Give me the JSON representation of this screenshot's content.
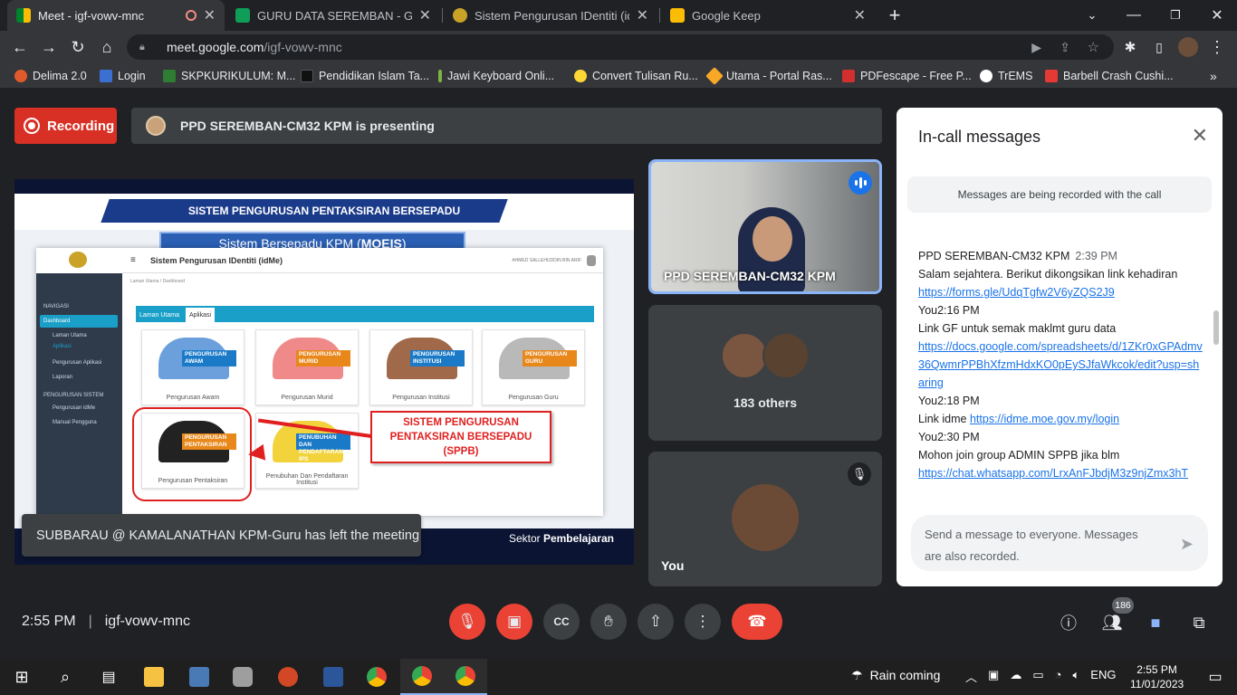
{
  "browser": {
    "tabs": [
      {
        "title": "Meet - igf-vowv-mnc",
        "active": true
      },
      {
        "title": "GURU DATA SEREMBAN - Google"
      },
      {
        "title": "Sistem Pengurusan IDentiti (idMe"
      },
      {
        "title": "Google Keep"
      }
    ],
    "url_domain": "meet.google.com",
    "url_path": "/igf-vowv-mnc",
    "bookmarks": [
      "Delima 2.0",
      "Login",
      "SKPKURIKULUM: M...",
      "Pendidikan Islam Ta...",
      "Jawi Keyboard Onli...",
      "Convert Tulisan Ru...",
      "Utama - Portal Ras...",
      "PDFescape - Free P...",
      "TrEMS",
      "Barbell Crash Cushi..."
    ]
  },
  "meet": {
    "recording_label": "Recording",
    "presenting_text": "PPD SEREMBAN-CM32 KPM is presenting",
    "slide": {
      "title": "SISTEM PENGURUSAN PENTAKSIRAN BERSEPADU",
      "subtitle_prefix": "Sistem Bersepadu KPM (",
      "subtitle_bold": "MOEIS",
      "subtitle_suffix": ")",
      "app_title": "Sistem Pengurusan IDentiti (idMe)",
      "app_user": "AHMED SALLEHUDDIN BIN ARIF",
      "breadcrumb": "Laman Utama  /  Dashboard",
      "sidebar": [
        "NAVIGASI",
        "Dashboard",
        "Laman Utama",
        "Aplikasi",
        "Pengurusan Aplikasi",
        "Laporan",
        "PENGURUSAN SISTEM",
        "Pengurusan idMe",
        "Manual Pengguna"
      ],
      "tabs": [
        "Laman Utama",
        "Aplikasi"
      ],
      "cards": [
        {
          "caption": "Pengurusan Awam",
          "l1": "PENGURUSAN",
          "l2": "AWAM"
        },
        {
          "caption": "Pengurusan Murid",
          "l1": "PENGURUSAN",
          "l2": "MURID"
        },
        {
          "caption": "Pengurusan Institusi",
          "l1": "PENGURUSAN",
          "l2": "INSTITUSI"
        },
        {
          "caption": "Pengurusan Guru",
          "l1": "PENGURUSAN",
          "l2": "GURU"
        },
        {
          "caption": "Pengurusan Pentaksiran",
          "l1": "PENGURUSAN",
          "l2": "PENTAKSIRAN"
        },
        {
          "caption": "Penubuhan Dan Pendaftaran Institusi",
          "l1": "PENUBUHAN DAN",
          "l2": "PENDAFTARAN IPS"
        }
      ],
      "card_subtext": "KEMENTERIAN PENDIDIKAN",
      "callout": "SISTEM PENGURUSAN PENTAKSIRAN BERSEPADU (SPPB)",
      "footer_prefix": "Sektor ",
      "footer_bold": "Pembelajaran"
    },
    "toast": "SUBBARAU @ KAMALANATHAN KPM-Guru has left the meeting",
    "tiles": {
      "presenter_name": "PPD SEREMBAN-CM32 KPM",
      "others_label": "183 others",
      "self_label": "You"
    },
    "meeting_time": "2:55 PM",
    "meeting_code": "igf-vowv-mnc",
    "participant_count": "186"
  },
  "chat": {
    "title": "In-call messages",
    "notice": "Messages are being recorded with the call",
    "sender": "PPD SEREMBAN-CM32 KPM",
    "sender_time": "2:39 PM",
    "messages": [
      {
        "text": "Salam sejahtera. Berikut dikongsikan link kehadiran"
      },
      {
        "link": "https://forms.gle/UdqTgfw2V6yZQS2J9"
      },
      {
        "text": "You2:16 PM"
      },
      {
        "text": "Link GF untuk semak maklmt guru data"
      },
      {
        "link": "https://docs.google.com/spreadsheets/d/1ZKr0xGPAdmv36QwmrPPBhXfzmHdxKO0pEySJfaWkcok/edit?usp=sharing"
      },
      {
        "text": "You2:18 PM"
      },
      {
        "text": "Link idme ",
        "link": "https://idme.moe.gov.my/login"
      },
      {
        "text": "You2:30 PM"
      },
      {
        "text": "Mohon join group ADMIN SPPB jika blm"
      },
      {
        "link": "https://chat.whatsapp.com/LrxAnFJbdjM3z9njZmx3hT"
      }
    ],
    "compose_placeholder": "Send a message to everyone. Messages are also recorded."
  },
  "taskbar": {
    "weather": "Rain coming",
    "lang": "ENG",
    "time": "2:55 PM",
    "date": "11/01/2023"
  }
}
